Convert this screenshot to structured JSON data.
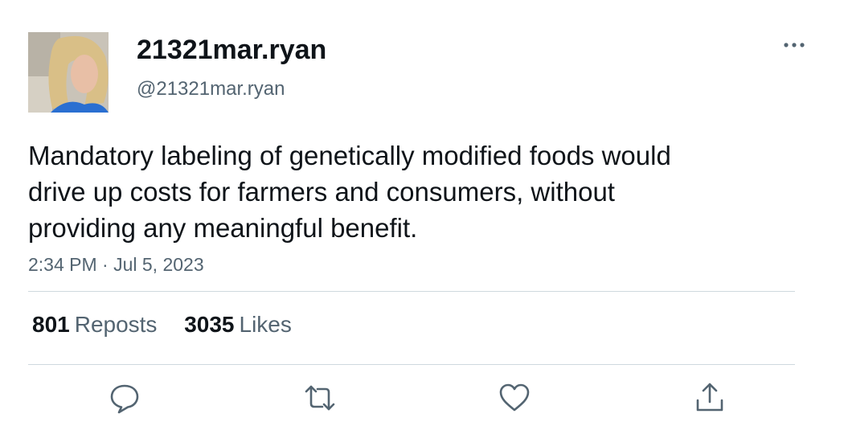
{
  "author": {
    "display_name": "21321mar.ryan",
    "handle": "@21321mar.ryan",
    "avatar_icon": "profile-photo"
  },
  "tweet": {
    "text": "Mandatory labeling of genetically modified foods would\ndrive up costs for farmers and consumers, without\nproviding any meaningful benefit.",
    "timestamp": "2:34 PM · Jul 5, 2023"
  },
  "stats": {
    "reposts_count": "801",
    "reposts_label": "Reposts",
    "likes_count": "3035",
    "likes_label": "Likes"
  },
  "actions": [
    "reply-icon",
    "repost-icon",
    "like-icon",
    "share-icon"
  ],
  "colors": {
    "text_primary": "#0f1419",
    "text_secondary": "#536471",
    "divider": "#cfd9de",
    "icon": "#536471"
  }
}
